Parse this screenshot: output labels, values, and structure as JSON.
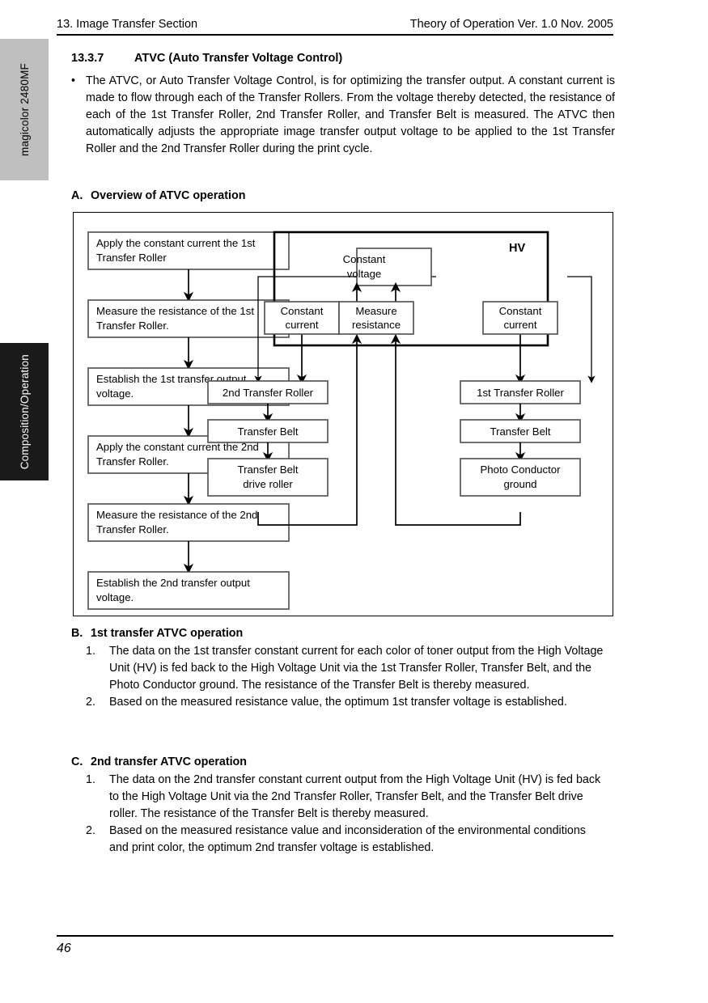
{
  "side_tabs": {
    "product": "magicolor 2480MF",
    "chapter": "Composition/Operation"
  },
  "header": {
    "left": "13. Image Transfer Section",
    "right": "Theory of Operation Ver. 1.0 Nov. 2005"
  },
  "footer": {
    "page_number": "46"
  },
  "section": {
    "number": "13.3.7",
    "title": "ATVC (Auto Transfer Voltage Control)",
    "bullet_marker": "•",
    "intro": "The ATVC, or Auto Transfer Voltage Control, is for optimizing the transfer output. A constant current is made to flow through each of the Transfer Rollers. From the voltage thereby detected, the resistance of each of the 1st Transfer Roller, 2nd Transfer Roller, and Transfer Belt is measured. The ATVC then automatically adjusts the appropriate image transfer output voltage to be applied to the 1st Transfer Roller and the 2nd Transfer Roller during the print cycle."
  },
  "block_a": {
    "letter": "A.",
    "title": "Overview of ATVC operation"
  },
  "block_b": {
    "letter": "B.",
    "title": "1st transfer ATVC operation",
    "items": [
      {
        "index": "1.",
        "text": "The data on the 1st transfer constant current for each color of toner output from the High Voltage Unit (HV) is fed back to the High Voltage Unit via the 1st Transfer Roller, Transfer Belt, and the Photo Conductor ground. The resistance of the Transfer Belt is thereby measured."
      },
      {
        "index": "2.",
        "text": "Based on the measured resistance value, the optimum 1st transfer voltage is established."
      }
    ]
  },
  "block_c": {
    "letter": "C.",
    "title": "2nd transfer ATVC operation",
    "items": [
      {
        "index": "1.",
        "text": "The data on the 2nd transfer constant current output from the High Voltage Unit (HV) is fed back to the High Voltage Unit via the 2nd Transfer Roller, Transfer Belt, and the Transfer Belt drive roller. The resistance of the Transfer Belt is thereby measured."
      },
      {
        "index": "2.",
        "text": "Based on the measured resistance value and inconsideration of the environmental conditions and print color, the optimum 2nd transfer voltage is established."
      }
    ]
  },
  "diagram": {
    "flowchart": {
      "steps": [
        {
          "line1": "Apply the constant current the 1st",
          "line2": "Transfer Roller"
        },
        {
          "line1": "Measure the resistance of the 1st",
          "line2": "Transfer Roller."
        },
        {
          "line1": "Establish the 1st transfer output",
          "line2": "voltage."
        },
        {
          "line1": "Apply the constant current the 2nd",
          "line2": "Transfer Roller."
        },
        {
          "line1": "Measure the resistance of the 2nd",
          "line2": "Transfer Roller."
        },
        {
          "line1": "Establish the 2nd transfer output",
          "line2": "voltage."
        }
      ]
    },
    "hv": {
      "label": "HV",
      "constant_voltage": {
        "line1": "Constant",
        "line2": "voltage"
      },
      "constant_current_left": {
        "line1": "Constant",
        "line2": "current"
      },
      "measure_resistance": {
        "line1": "Measure",
        "line2": "resistance"
      },
      "constant_current_right": {
        "line1": "Constant",
        "line2": "current"
      }
    },
    "left_chain": [
      {
        "line1": "2nd Transfer Roller",
        "line2": ""
      },
      {
        "line1": "Transfer Belt",
        "line2": ""
      },
      {
        "line1": "Transfer Belt",
        "line2": "drive roller"
      }
    ],
    "right_chain": [
      {
        "line1": "1st Transfer Roller",
        "line2": ""
      },
      {
        "line1": "Transfer Belt",
        "line2": ""
      },
      {
        "line1": "Photo Conductor",
        "line2": "ground"
      }
    ]
  },
  "colors": {
    "tab_gray": "#bfbfbf",
    "tab_black": "#1a1a1a",
    "box_stroke": "#4d4d4d",
    "wire": "#000000"
  }
}
